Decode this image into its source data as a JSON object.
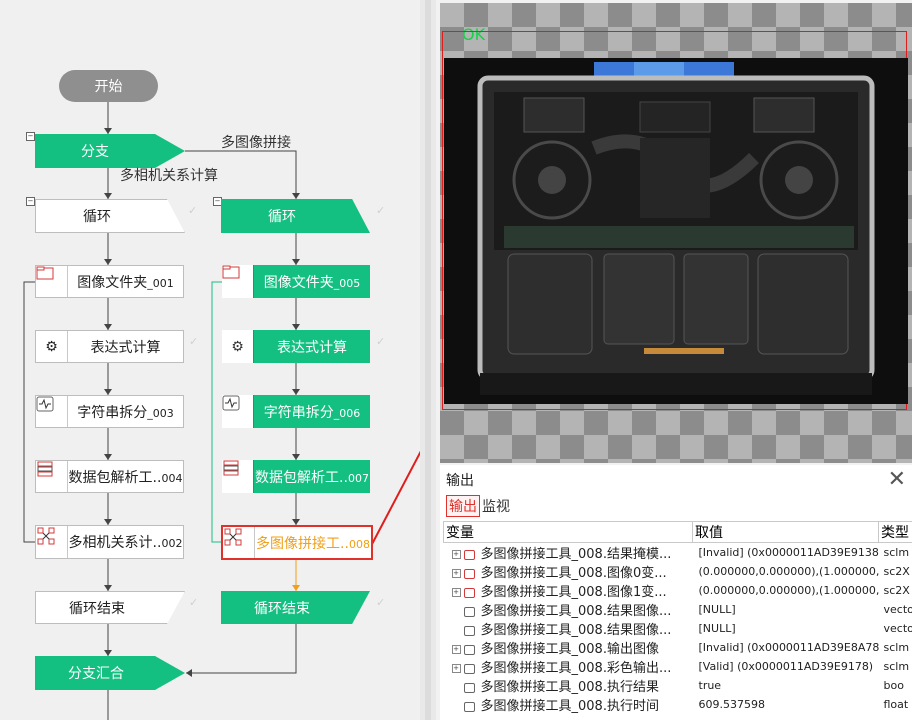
{
  "flow": {
    "start": "开始",
    "branch": "分支",
    "branch_label_left": "多相机关系计算",
    "branch_label_right": "多图像拼接",
    "left": {
      "loop": "循环",
      "folder": "图像文件夹",
      "folder_suffix": "_001",
      "expr": "表达式计算",
      "split": "字符串拆分",
      "split_suffix": "_003",
      "packet": "数据包解析工..",
      "packet_suffix": "004",
      "relation": "多相机关系计..",
      "relation_suffix": "002",
      "loop_end": "循环结束"
    },
    "right": {
      "loop": "循环",
      "folder": "图像文件夹",
      "folder_suffix": "_005",
      "expr": "表达式计算",
      "split": "字符串拆分",
      "split_suffix": "_006",
      "packet": "数据包解析工..",
      "packet_suffix": "007",
      "stitch": "多图像拼接工..",
      "stitch_suffix": "008",
      "loop_end": "循环结束"
    },
    "merge": "分支汇合"
  },
  "preview": {
    "status": "OK"
  },
  "output": {
    "title": "输出",
    "tab_output": "输出",
    "tab_monitor": "监视",
    "headers": [
      "变量",
      "取值",
      "类型"
    ],
    "rows": [
      {
        "expand": "+",
        "name": "多图像拼接工具_008.结果掩模...",
        "value": "[Invalid] (0x0000011AD39E9138)",
        "type": "sclm"
      },
      {
        "expand": "+",
        "name": "多图像拼接工具_008.图像0变...",
        "value": "(0.000000,0.000000),(1.000000,...",
        "type": "sc2X"
      },
      {
        "expand": "+",
        "name": "多图像拼接工具_008.图像1变...",
        "value": "(0.000000,0.000000),(1.000000,...",
        "type": "sc2X"
      },
      {
        "expand": "",
        "name": "多图像拼接工具_008.结果图像...",
        "value": "[NULL]",
        "type": "vecto"
      },
      {
        "expand": "",
        "name": "多图像拼接工具_008.结果图像...",
        "value": "[NULL]",
        "type": "vecto"
      },
      {
        "expand": "+",
        "name": "多图像拼接工具_008.输出图像",
        "value": "[Invalid] (0x0000011AD39E8A78)",
        "type": "sclm"
      },
      {
        "expand": "+",
        "name": "多图像拼接工具_008.彩色输出...",
        "value": "[Valid] (0x0000011AD39E9178)",
        "type": "sclm"
      },
      {
        "expand": "",
        "name": "多图像拼接工具_008.执行结果",
        "value": "true",
        "type": "boo"
      },
      {
        "expand": "",
        "name": "多图像拼接工具_008.执行时间",
        "value": "609.537598",
        "type": "float"
      }
    ]
  }
}
